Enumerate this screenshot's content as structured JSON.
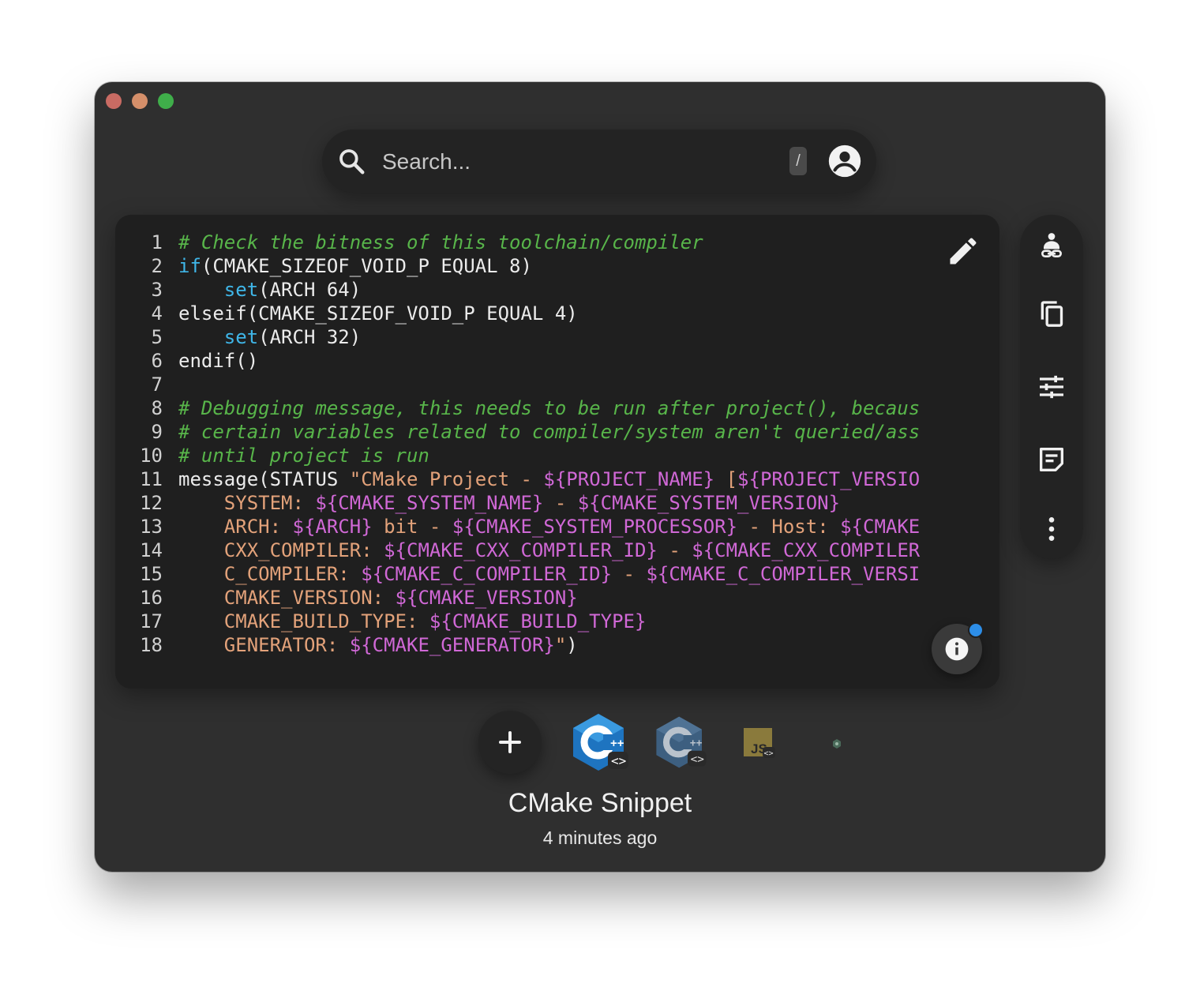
{
  "search": {
    "placeholder": "Search...",
    "shortcut": "/"
  },
  "code": {
    "lines": [
      {
        "n": "1",
        "tokens": [
          {
            "t": "comment",
            "v": "# Check the bitness of this toolchain/compiler"
          }
        ]
      },
      {
        "n": "2",
        "tokens": [
          {
            "t": "kw",
            "v": "if"
          },
          {
            "t": "plain",
            "v": "(CMAKE_SIZEOF_VOID_P EQUAL 8)"
          }
        ]
      },
      {
        "n": "3",
        "tokens": [
          {
            "t": "plain",
            "v": "    "
          },
          {
            "t": "kw",
            "v": "set"
          },
          {
            "t": "plain",
            "v": "(ARCH 64)"
          }
        ]
      },
      {
        "n": "4",
        "tokens": [
          {
            "t": "plain",
            "v": "elseif(CMAKE_SIZEOF_VOID_P EQUAL 4)"
          }
        ]
      },
      {
        "n": "5",
        "tokens": [
          {
            "t": "plain",
            "v": "    "
          },
          {
            "t": "kw",
            "v": "set"
          },
          {
            "t": "plain",
            "v": "(ARCH 32)"
          }
        ]
      },
      {
        "n": "6",
        "tokens": [
          {
            "t": "plain",
            "v": "endif()"
          }
        ]
      },
      {
        "n": "7",
        "tokens": []
      },
      {
        "n": "8",
        "tokens": [
          {
            "t": "comment",
            "v": "# Debugging message, this needs to be run after project(), becaus"
          }
        ]
      },
      {
        "n": "9",
        "tokens": [
          {
            "t": "comment",
            "v": "# certain variables related to compiler/system aren't queried/ass"
          }
        ]
      },
      {
        "n": "10",
        "tokens": [
          {
            "t": "comment",
            "v": "# until project is run"
          }
        ]
      },
      {
        "n": "11",
        "tokens": [
          {
            "t": "plain",
            "v": "message(STATUS "
          },
          {
            "t": "str",
            "v": "\"CMake Project - "
          },
          {
            "t": "var",
            "v": "${PROJECT_NAME}"
          },
          {
            "t": "str",
            "v": " ["
          },
          {
            "t": "var",
            "v": "${PROJECT_VERSIO"
          }
        ]
      },
      {
        "n": "12",
        "tokens": [
          {
            "t": "str",
            "v": "    SYSTEM: "
          },
          {
            "t": "var",
            "v": "${CMAKE_SYSTEM_NAME}"
          },
          {
            "t": "str",
            "v": " - "
          },
          {
            "t": "var",
            "v": "${CMAKE_SYSTEM_VERSION}"
          }
        ]
      },
      {
        "n": "13",
        "tokens": [
          {
            "t": "str",
            "v": "    ARCH: "
          },
          {
            "t": "var",
            "v": "${ARCH}"
          },
          {
            "t": "str",
            "v": " bit - "
          },
          {
            "t": "var",
            "v": "${CMAKE_SYSTEM_PROCESSOR}"
          },
          {
            "t": "str",
            "v": " - Host: "
          },
          {
            "t": "var",
            "v": "${CMAKE"
          }
        ]
      },
      {
        "n": "14",
        "tokens": [
          {
            "t": "str",
            "v": "    CXX_COMPILER: "
          },
          {
            "t": "var",
            "v": "${CMAKE_CXX_COMPILER_ID}"
          },
          {
            "t": "str",
            "v": " - "
          },
          {
            "t": "var",
            "v": "${CMAKE_CXX_COMPILER"
          }
        ]
      },
      {
        "n": "15",
        "tokens": [
          {
            "t": "str",
            "v": "    C_COMPILER: "
          },
          {
            "t": "var",
            "v": "${CMAKE_C_COMPILER_ID}"
          },
          {
            "t": "str",
            "v": " - "
          },
          {
            "t": "var",
            "v": "${CMAKE_C_COMPILER_VERSI"
          }
        ]
      },
      {
        "n": "16",
        "tokens": [
          {
            "t": "str",
            "v": "    CMAKE_VERSION: "
          },
          {
            "t": "var",
            "v": "${CMAKE_VERSION}"
          }
        ]
      },
      {
        "n": "17",
        "tokens": [
          {
            "t": "str",
            "v": "    CMAKE_BUILD_TYPE: "
          },
          {
            "t": "var",
            "v": "${CMAKE_BUILD_TYPE}"
          }
        ]
      },
      {
        "n": "18",
        "tokens": [
          {
            "t": "str",
            "v": "    GENERATOR: "
          },
          {
            "t": "var",
            "v": "${CMAKE_GENERATOR}"
          },
          {
            "t": "str",
            "v": "\""
          },
          {
            "t": "plain",
            "v": ")"
          }
        ]
      }
    ]
  },
  "sidebar": {
    "buttons": [
      "share-link-icon",
      "copy-icon",
      "tune-icon",
      "notes-icon",
      "more-vert-icon"
    ]
  },
  "snippet": {
    "title": "CMake Snippet",
    "time": "4 minutes ago",
    "languages": [
      {
        "icon": "cpp-logo-icon",
        "label": "C++",
        "active": true
      },
      {
        "icon": "cpp-logo-icon",
        "label": "C++",
        "active": false
      },
      {
        "icon": "javascript-logo-icon",
        "label": "JS",
        "active": false
      },
      {
        "icon": "small-language-icon",
        "label": "",
        "active": false
      }
    ]
  },
  "colors": {
    "comment": "#58b54a",
    "keyword": "#3fb6e8",
    "string": "#e3a27a",
    "variable": "#d068d6",
    "notification": "#2d8ee8"
  }
}
